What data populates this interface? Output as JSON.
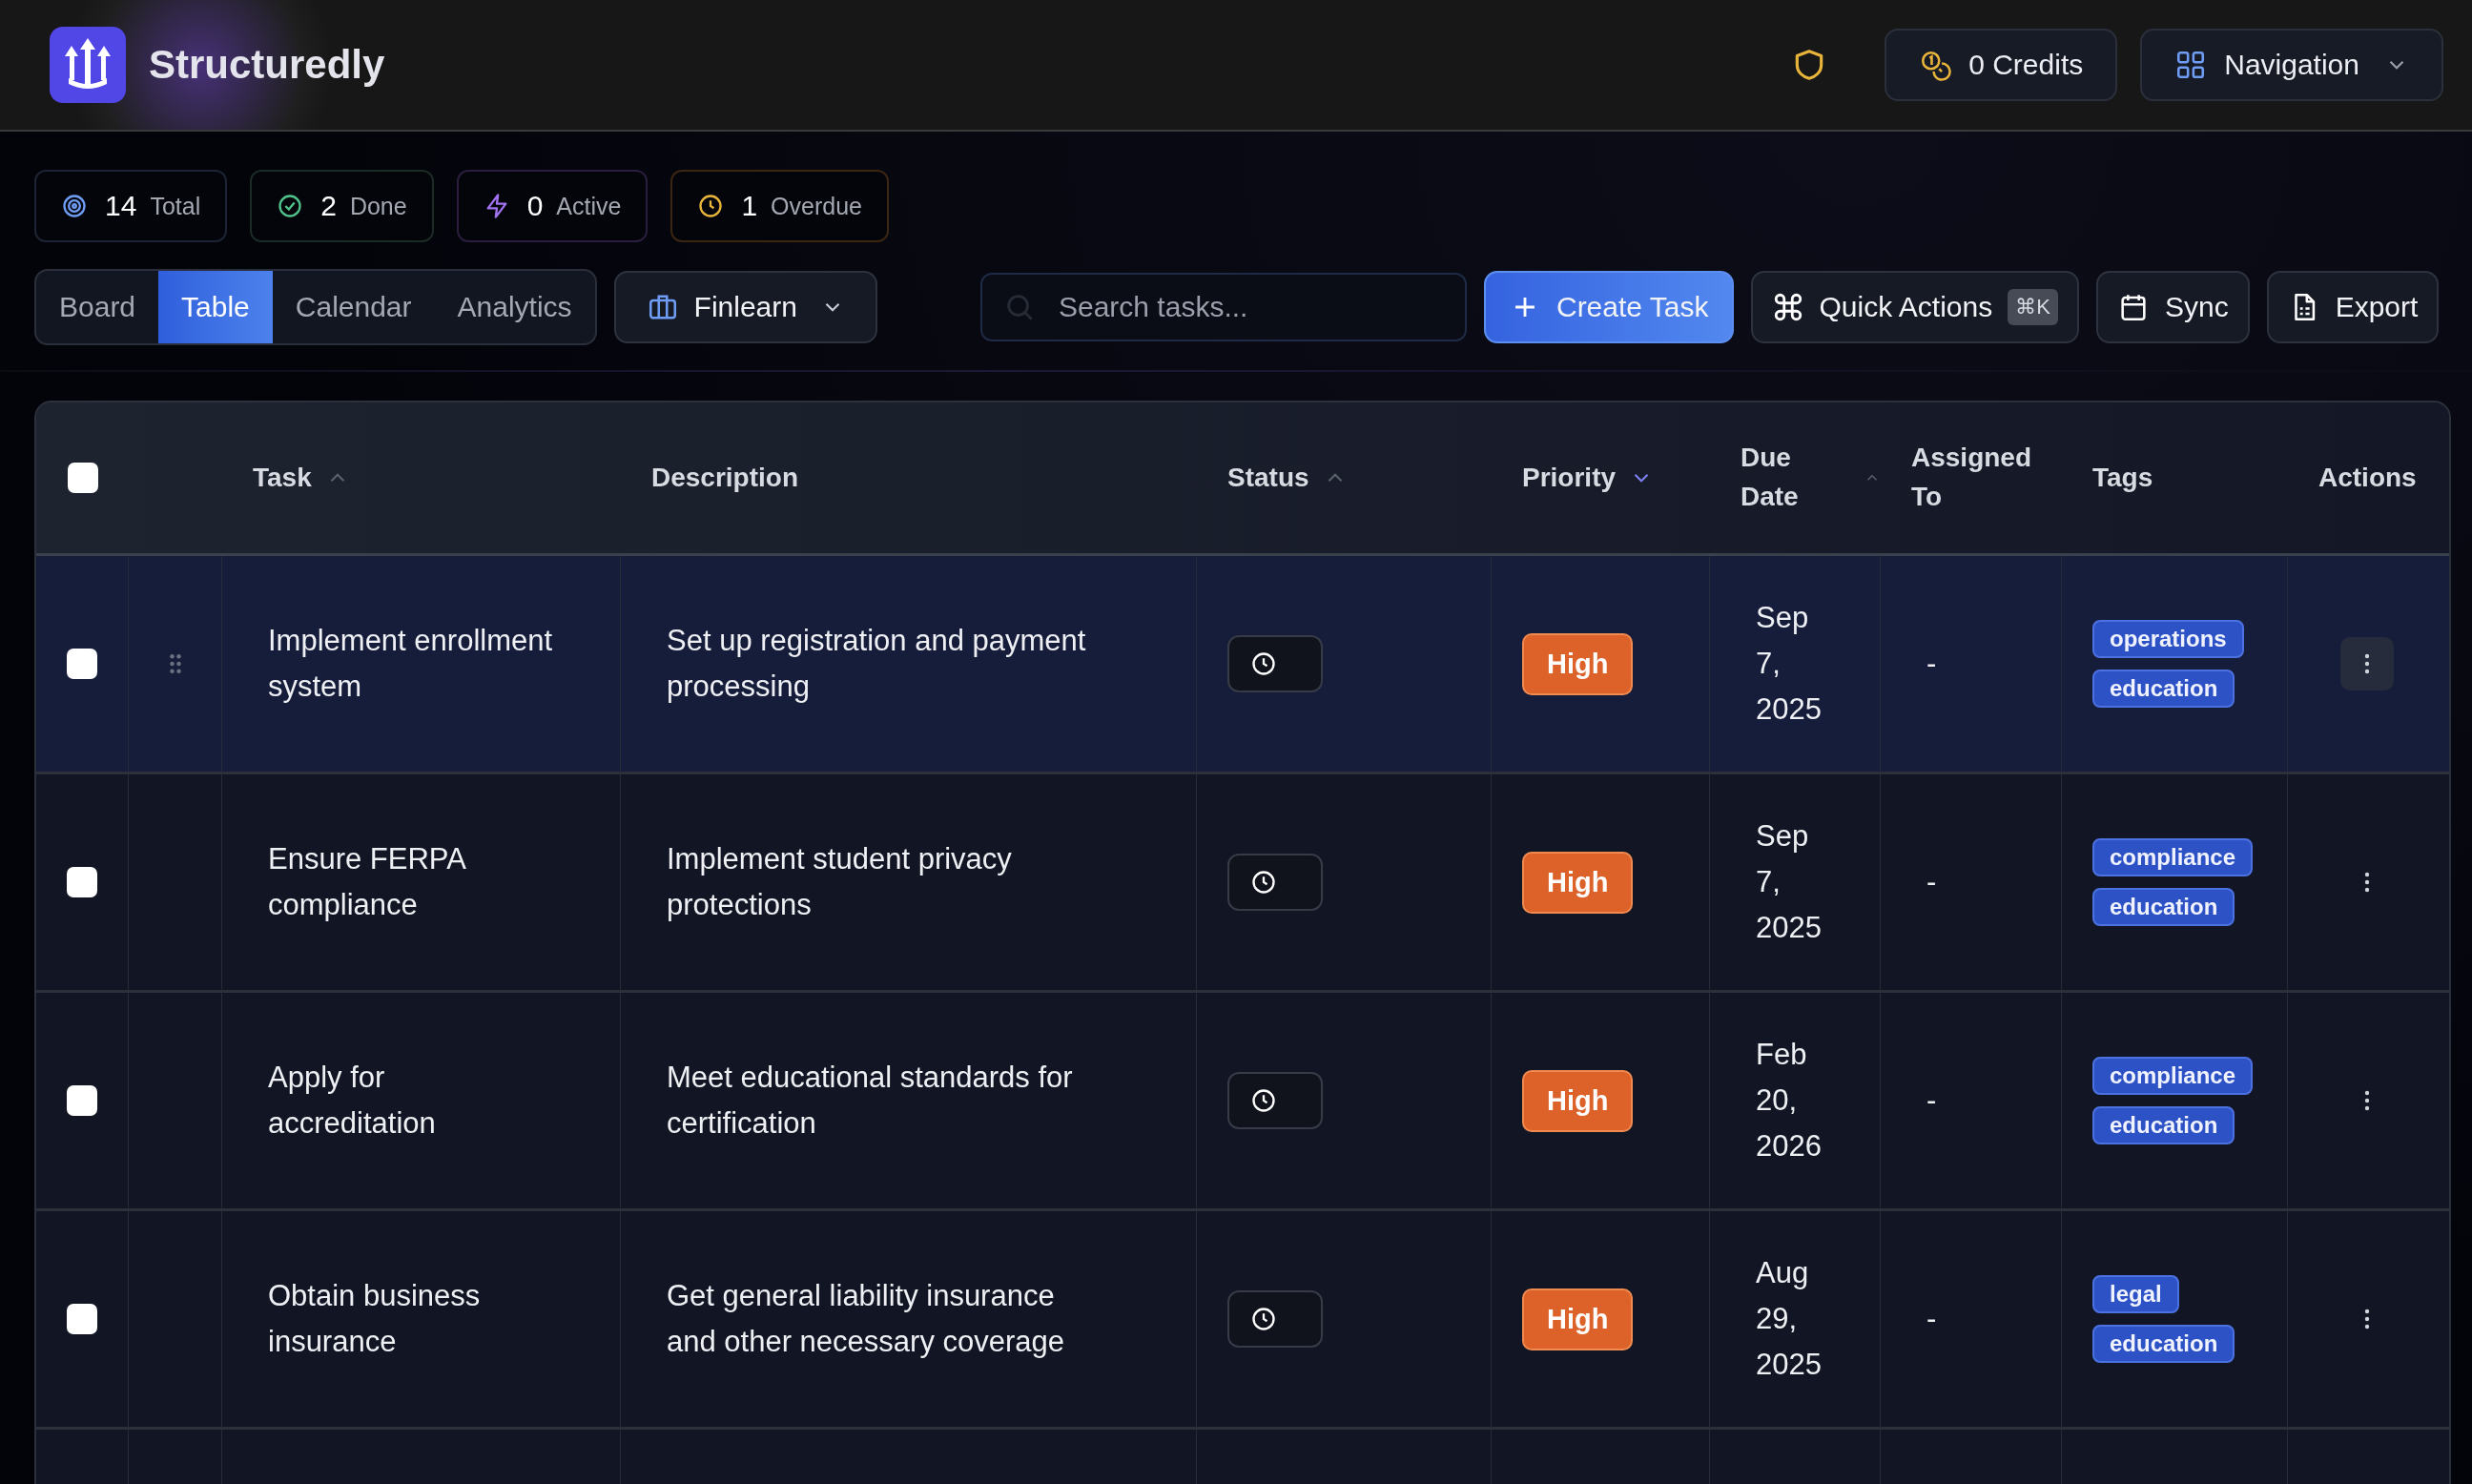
{
  "app": {
    "title": "Structuredly"
  },
  "header": {
    "credits": "0 Credits",
    "navigation": "Navigation"
  },
  "stats": [
    {
      "kind": "total",
      "value": "14",
      "label": "Total"
    },
    {
      "kind": "done",
      "value": "2",
      "label": "Done"
    },
    {
      "kind": "active",
      "value": "0",
      "label": "Active"
    },
    {
      "kind": "overdue",
      "value": "1",
      "label": "Overdue"
    }
  ],
  "view_tabs": [
    {
      "label": "Board",
      "selected": false
    },
    {
      "label": "Table",
      "selected": true
    },
    {
      "label": "Calendar",
      "selected": false
    },
    {
      "label": "Analytics",
      "selected": false
    }
  ],
  "project": "Finlearn",
  "search": {
    "placeholder": "Search tasks..."
  },
  "actions": {
    "create": "Create Task",
    "quick": "Quick Actions",
    "shortcut": "⌘K",
    "sync": "Sync",
    "export": "Export"
  },
  "table": {
    "all_checked": false,
    "columns": [
      {
        "label": "Task",
        "sortable": true,
        "descending": false,
        "active": false
      },
      {
        "label": "Description"
      },
      {
        "label": "Status",
        "sortable": true,
        "descending": false,
        "active": false
      },
      {
        "label": "Priority",
        "sortable": true,
        "descending": true,
        "active": true
      },
      {
        "label": "Due Date",
        "sortable": true,
        "descending": false,
        "active": false
      },
      {
        "label": "Assigned To"
      },
      {
        "label": "Tags"
      },
      {
        "label": "Actions"
      }
    ],
    "rows": [
      {
        "highlighted": true,
        "checked": false,
        "task": "Implement enrollment system",
        "description": "Set up registration and payment processing",
        "priority": "High",
        "due": "Sep 7, 2025",
        "assigned": "-",
        "tags": [
          "operations",
          "education"
        ]
      },
      {
        "highlighted": false,
        "checked": false,
        "task": "Ensure FERPA compliance",
        "description": "Implement student privacy protections",
        "priority": "High",
        "due": "Sep 7, 2025",
        "assigned": "-",
        "tags": [
          "compliance",
          "education"
        ]
      },
      {
        "highlighted": false,
        "checked": false,
        "task": "Apply for accreditation",
        "description": "Meet educational standards for certification",
        "priority": "High",
        "due": "Feb 20, 2026",
        "assigned": "-",
        "tags": [
          "compliance",
          "education"
        ]
      },
      {
        "highlighted": false,
        "checked": false,
        "task": "Obtain business insurance",
        "description": "Get general liability insurance and other necessary coverage",
        "priority": "High",
        "due": "Aug 29, 2025",
        "assigned": "-",
        "tags": [
          "legal",
          "education"
        ]
      }
    ]
  }
}
